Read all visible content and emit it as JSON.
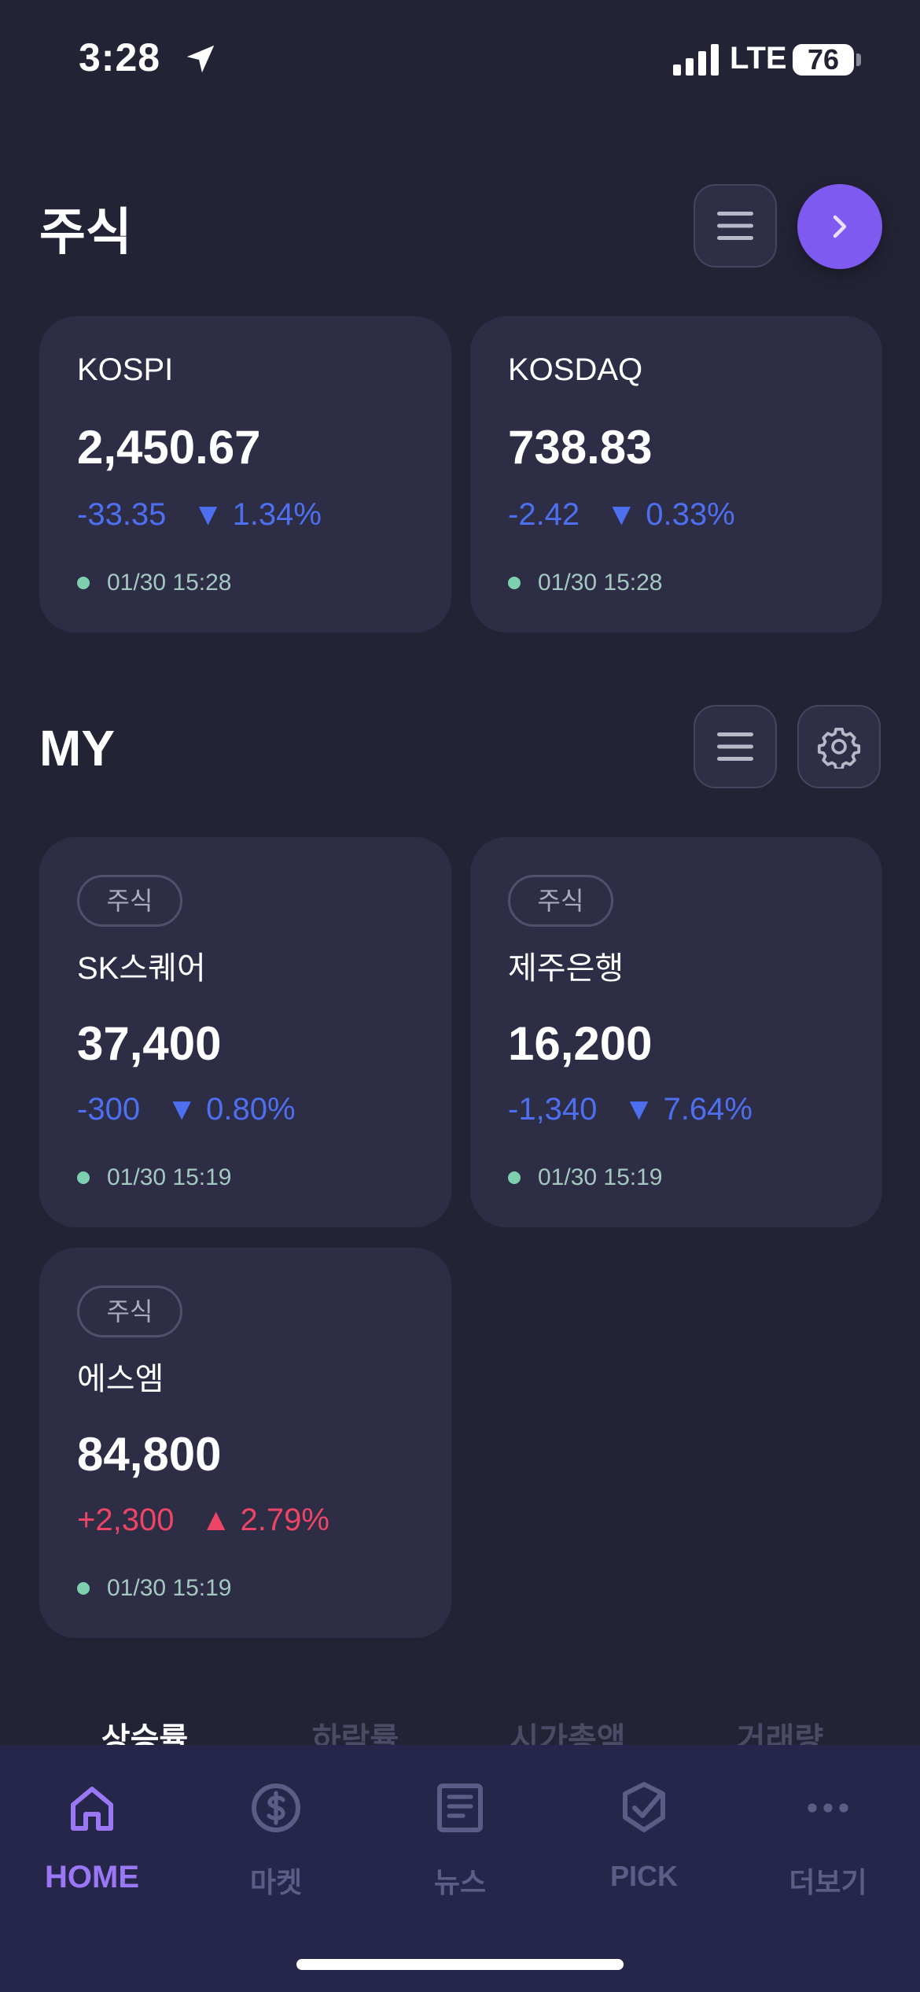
{
  "status_bar": {
    "time": "3:28",
    "network": "LTE",
    "battery": "76"
  },
  "stocks_section": {
    "title": "주식"
  },
  "indices": [
    {
      "name": "KOSPI",
      "price": "2,450.67",
      "change": "-33.35",
      "change_pct": "▼ 1.34%",
      "direction": "down",
      "timestamp": "01/30 15:28"
    },
    {
      "name": "KOSDAQ",
      "price": "738.83",
      "change": "-2.42",
      "change_pct": "▼ 0.33%",
      "direction": "down",
      "timestamp": "01/30 15:28"
    }
  ],
  "my_section": {
    "title": "MY"
  },
  "my_stocks": [
    {
      "tag": "주식",
      "name": "SK스퀘어",
      "price": "37,400",
      "change": "-300",
      "change_pct": "▼ 0.80%",
      "direction": "down",
      "timestamp": "01/30 15:19"
    },
    {
      "tag": "주식",
      "name": "제주은행",
      "price": "16,200",
      "change": "-1,340",
      "change_pct": "▼ 7.64%",
      "direction": "down",
      "timestamp": "01/30 15:19"
    },
    {
      "tag": "주식",
      "name": "에스엠",
      "price": "84,800",
      "change": "+2,300",
      "change_pct": "▲ 2.79%",
      "direction": "up",
      "timestamp": "01/30 15:19"
    }
  ],
  "sort_tabs": [
    "상승률",
    "하락률",
    "시가총액",
    "거래량"
  ],
  "bottom_nav": [
    {
      "label": "HOME",
      "icon": "home-icon",
      "active": true
    },
    {
      "label": "마켓",
      "icon": "dollar-icon",
      "active": false
    },
    {
      "label": "뉴스",
      "icon": "news-icon",
      "active": false
    },
    {
      "label": "PICK",
      "icon": "check-badge-icon",
      "active": false
    },
    {
      "label": "더보기",
      "icon": "more-icon",
      "active": false
    }
  ],
  "colors": {
    "background": "#232336",
    "card": "#2d2d46",
    "accent": "#7f5af0",
    "down": "#4d6ff0",
    "up": "#ee4466",
    "nav_bg": "#26264a"
  }
}
